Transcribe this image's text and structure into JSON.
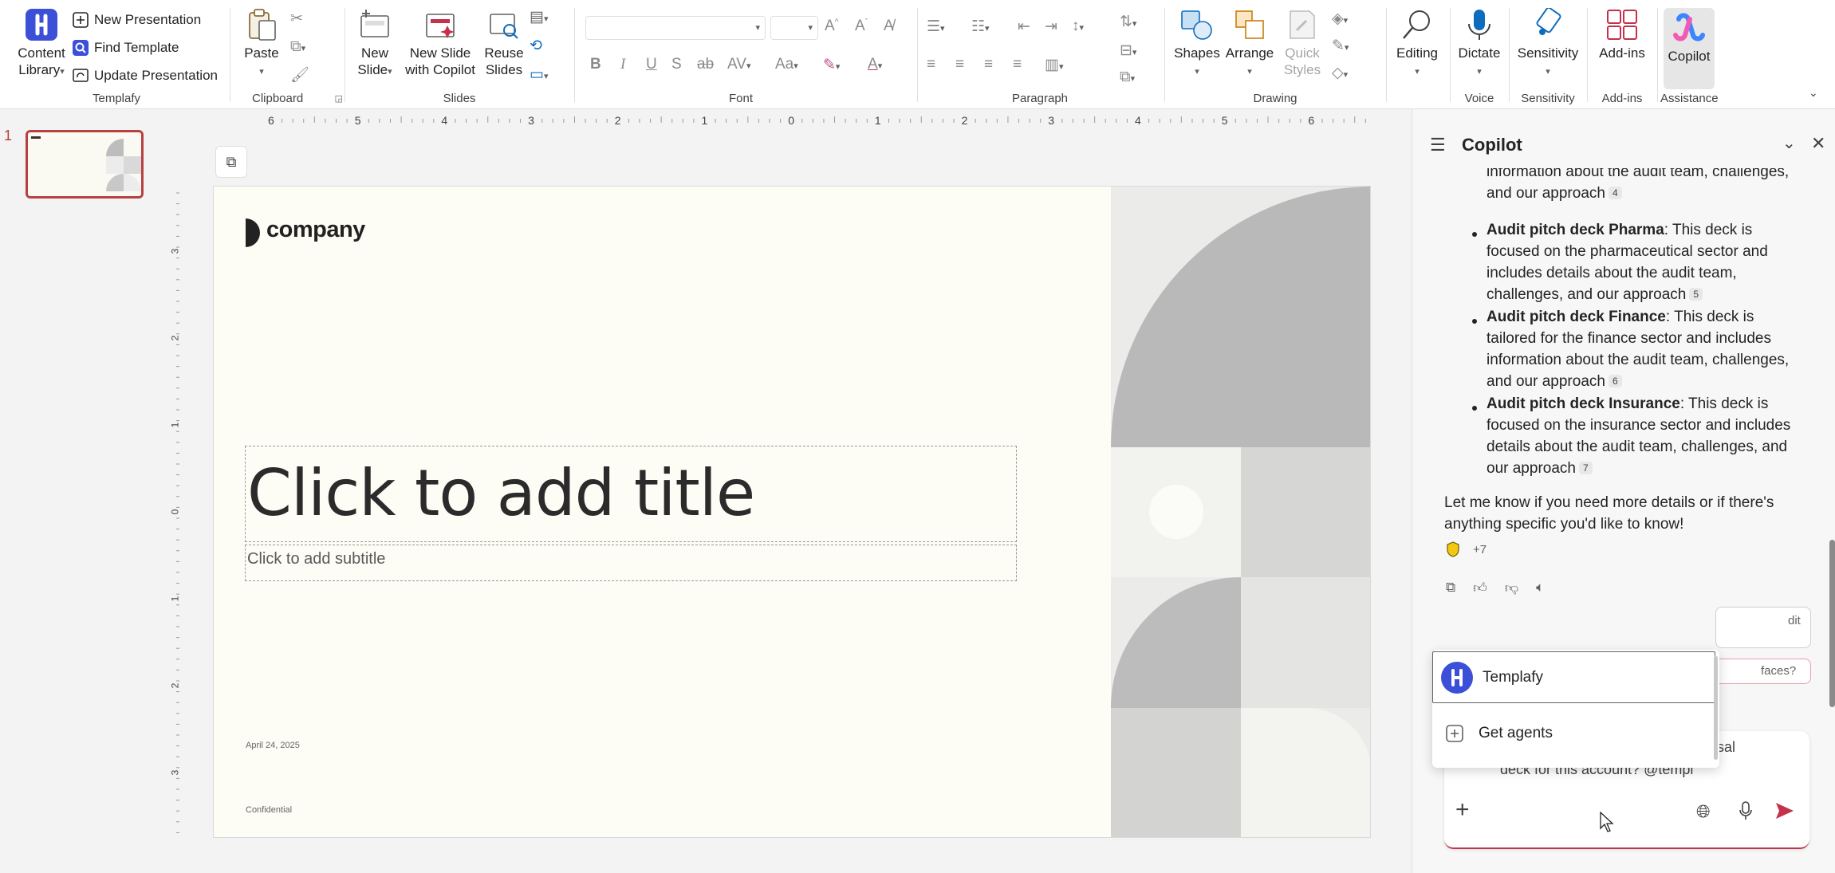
{
  "ribbon": {
    "templafy": {
      "content_library": "Content Library",
      "new_presentation": "New Presentation",
      "find_template": "Find Template",
      "update_presentation": "Update Presentation",
      "group": "Templafy"
    },
    "clipboard": {
      "paste": "Paste",
      "group": "Clipboard"
    },
    "slides": {
      "new_slide": "New Slide",
      "new_slide_copilot": "New Slide with Copilot",
      "reuse_slides": "Reuse Slides",
      "group": "Slides"
    },
    "font": {
      "group": "Font"
    },
    "paragraph": {
      "group": "Paragraph"
    },
    "drawing": {
      "shapes": "Shapes",
      "arrange": "Arrange",
      "quick_styles": "Quick Styles",
      "group": "Drawing"
    },
    "editing": {
      "label": "Editing"
    },
    "voice": {
      "dictate": "Dictate",
      "group": "Voice"
    },
    "sensitivity": {
      "label": "Sensitivity",
      "group": "Sensitivity"
    },
    "addins": {
      "label": "Add-ins",
      "group": "Add-ins"
    },
    "assistance": {
      "copilot": "Copilot",
      "group": "Assistance"
    }
  },
  "thumbnails": {
    "slide_number": "1"
  },
  "ruler": {
    "h_labels": [
      "6",
      "5",
      "4",
      "3",
      "2",
      "1",
      "0",
      "1",
      "2",
      "3",
      "4",
      "5",
      "6"
    ],
    "v_labels": [
      "3",
      "2",
      "1",
      "0",
      "1",
      "2",
      "3"
    ]
  },
  "slide": {
    "logo_text": "company",
    "title_placeholder": "Click to add title",
    "subtitle_placeholder": "Click to add subtitle",
    "date": "April 24, 2025",
    "footer": "Confidential"
  },
  "copilot": {
    "title": "Copilot",
    "items": [
      {
        "bold": "",
        "text": "information about the audit team, challenges, and our approach",
        "cite": "4"
      },
      {
        "bold": "Audit pitch deck Pharma",
        "text": ": This deck is focused on the pharmaceutical sector and includes details about the audit team, challenges, and our approach",
        "cite": "5"
      },
      {
        "bold": "Audit pitch deck Finance",
        "text": ": This deck is tailored for the finance sector and includes information about the audit team, challenges, and our approach",
        "cite": "6"
      },
      {
        "bold": "Audit pitch deck Insurance",
        "text": ": This deck is focused on the insurance sector and includes details about the audit team, challenges, and our approach",
        "cite": "7"
      }
    ],
    "closing": "Let me know if you need more details or if there's anything specific you'd like to know!",
    "sources_more": "+7",
    "popup": {
      "item1": "Templafy",
      "item2": "Get agents"
    },
    "chip1": "dit",
    "chip2": "faces?",
    "input_tail1": "oposal",
    "input_text": "deck for this account? @templ"
  },
  "colors": {
    "accent_red": "#c4314b",
    "templafy_blue": "#3b4fd8",
    "slide_bg": "#fdfcf5"
  }
}
